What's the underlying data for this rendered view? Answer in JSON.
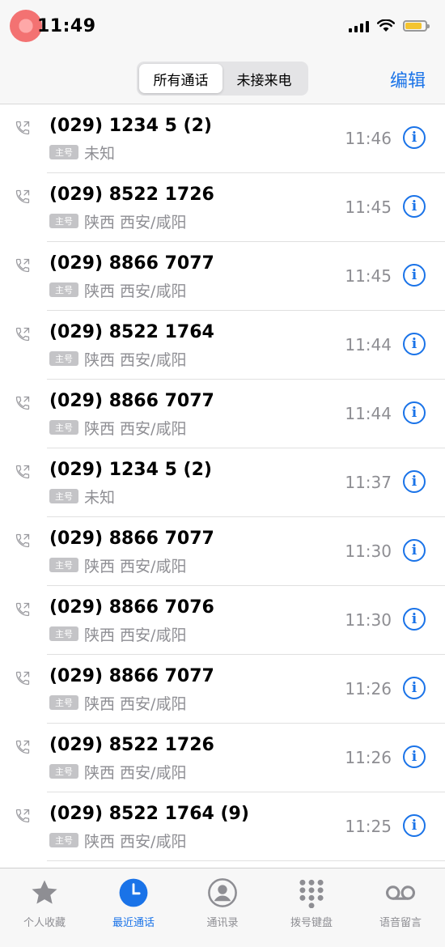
{
  "status_bar": {
    "time": "11:49"
  },
  "header": {
    "segments": [
      {
        "label": "所有通话",
        "active": true
      },
      {
        "label": "未接来电",
        "active": false
      }
    ],
    "edit_label": "编辑"
  },
  "calls": [
    {
      "number": "(029) 1234 5 (2)",
      "tag": "主号",
      "location": "未知",
      "time": "11:46"
    },
    {
      "number": "(029) 8522 1726",
      "tag": "主号",
      "location": "陕西 西安/咸阳",
      "time": "11:45"
    },
    {
      "number": "(029) 8866 7077",
      "tag": "主号",
      "location": "陕西 西安/咸阳",
      "time": "11:45"
    },
    {
      "number": "(029) 8522 1764",
      "tag": "主号",
      "location": "陕西 西安/咸阳",
      "time": "11:44"
    },
    {
      "number": "(029) 8866 7077",
      "tag": "主号",
      "location": "陕西 西安/咸阳",
      "time": "11:44"
    },
    {
      "number": "(029) 1234 5 (2)",
      "tag": "主号",
      "location": "未知",
      "time": "11:37"
    },
    {
      "number": "(029) 8866 7077",
      "tag": "主号",
      "location": "陕西 西安/咸阳",
      "time": "11:30"
    },
    {
      "number": "(029) 8866 7076",
      "tag": "主号",
      "location": "陕西 西安/咸阳",
      "time": "11:30"
    },
    {
      "number": "(029) 8866 7077",
      "tag": "主号",
      "location": "陕西 西安/咸阳",
      "time": "11:26"
    },
    {
      "number": "(029) 8522 1726",
      "tag": "主号",
      "location": "陕西 西安/咸阳",
      "time": "11:26"
    },
    {
      "number": "(029) 8522 1764 (9)",
      "tag": "主号",
      "location": "陕西 西安/咸阳",
      "time": "11:25"
    }
  ],
  "tabbar": {
    "items": [
      {
        "label": "个人收藏",
        "icon": "star-icon"
      },
      {
        "label": "最近通话",
        "icon": "clock-icon",
        "active": true
      },
      {
        "label": "通讯录",
        "icon": "contact-icon"
      },
      {
        "label": "拨号键盘",
        "icon": "keypad-icon"
      },
      {
        "label": "语音留言",
        "icon": "voicemail-icon"
      }
    ]
  },
  "colors": {
    "accent": "#1a73e8",
    "secondary_text": "#8e8e93",
    "tag_bg": "#c4c4c7",
    "battery": "#f4c430"
  }
}
